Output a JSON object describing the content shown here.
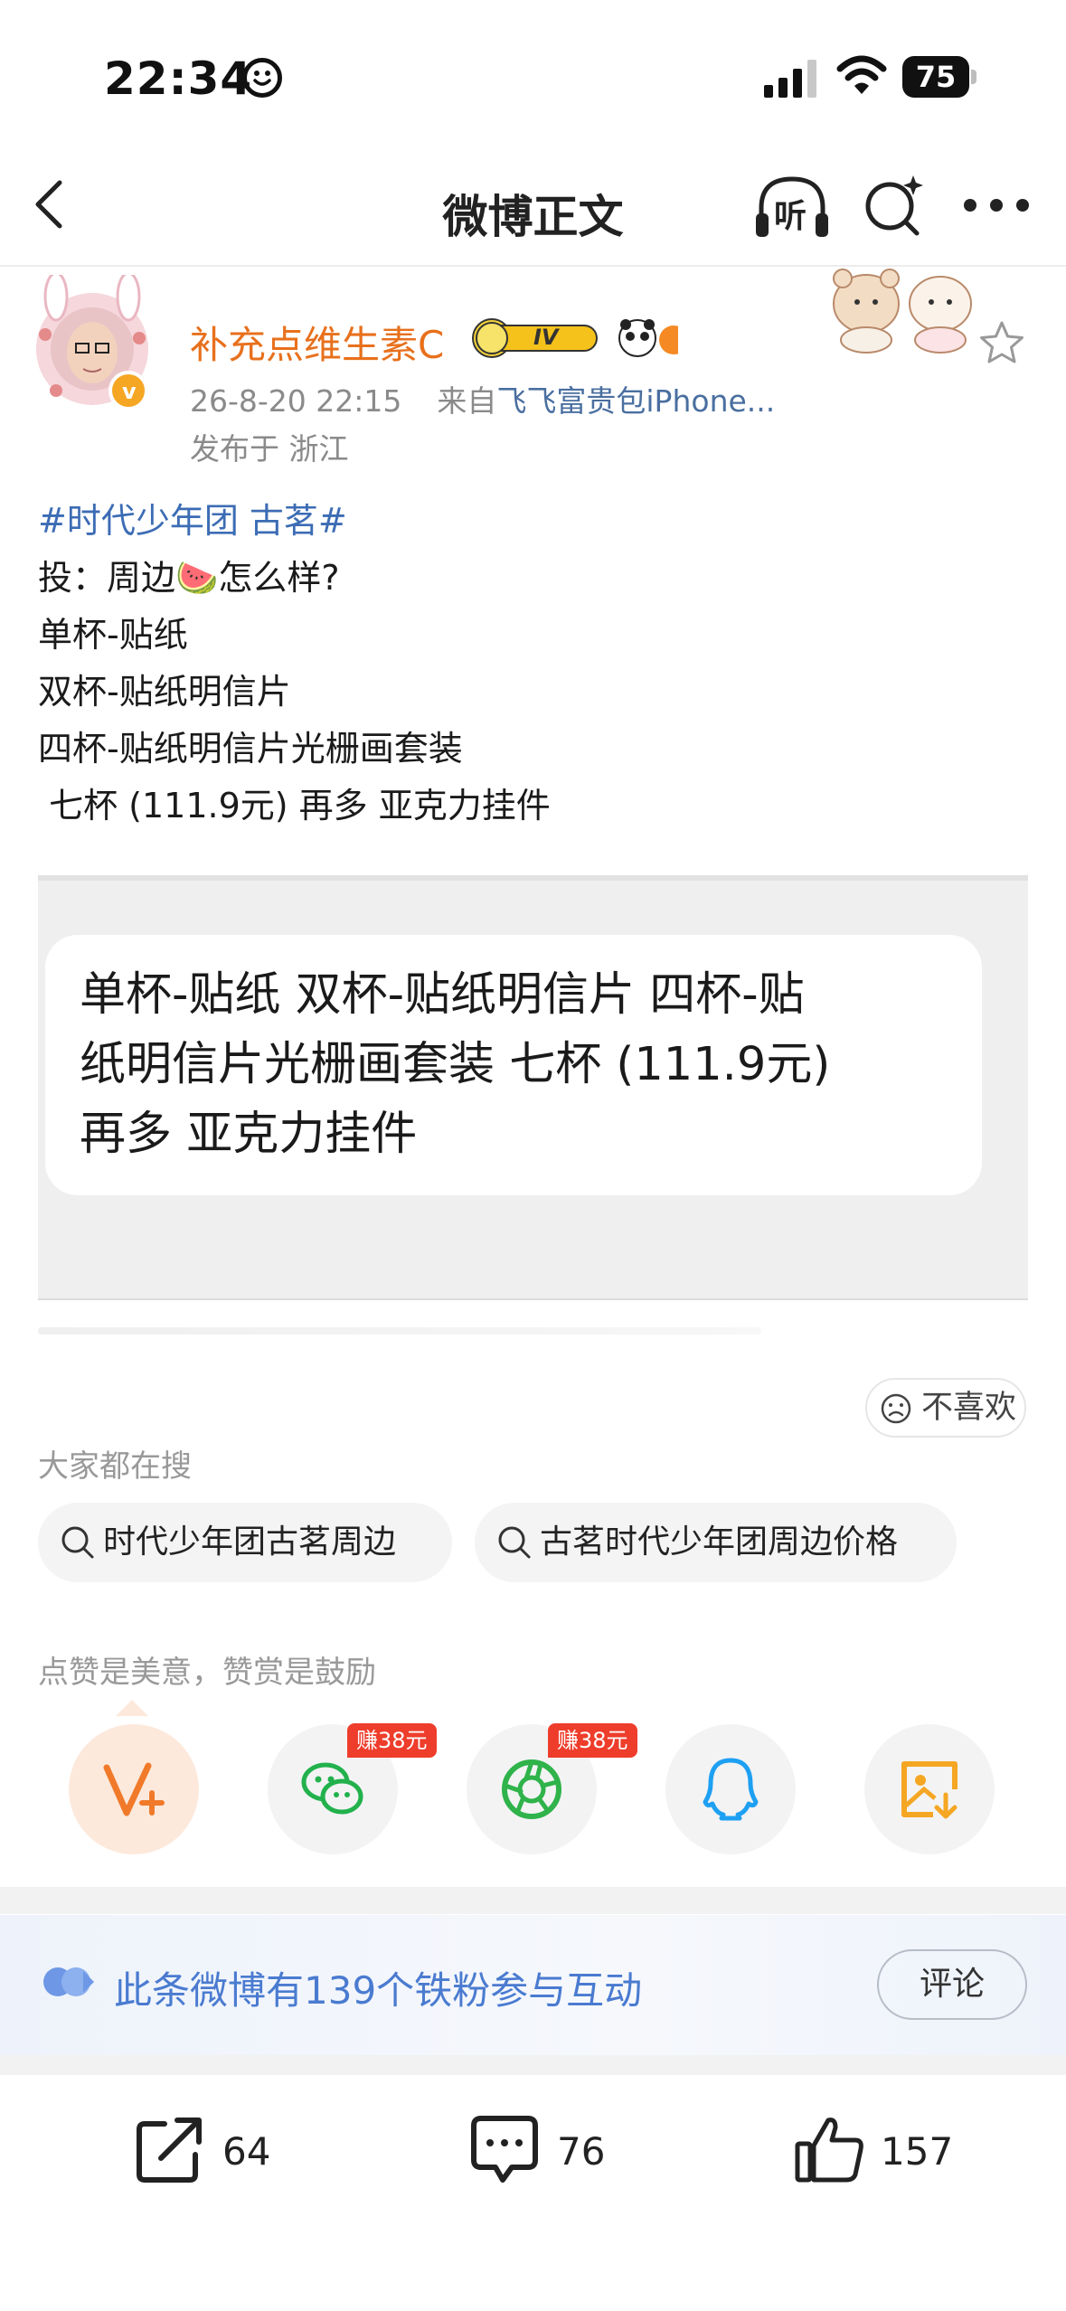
{
  "status_bar": {
    "time": "22:34",
    "battery": "75"
  },
  "nav": {
    "title": "微博正文",
    "listen_label": "听"
  },
  "post": {
    "username": "补充点维生素C",
    "badge_level": "IV",
    "date": "26-8-20 22:15",
    "source_prefix": "来自",
    "source": "飞飞富贵包iPhone...",
    "location": "发布于 浙江",
    "lines": [
      "#时代少年团 古茗#",
      "投：周边🍉怎么样?",
      "单杯-贴纸",
      "双杯-贴纸明信片",
      "四杯-贴纸明信片光栅画套装",
      " 七杯 (111.9元) 再多 亚克力挂件"
    ],
    "image_text_lines": [
      "单杯-贴纸 双杯-贴纸明信片 四杯-贴",
      "纸明信片光栅画套装 七杯 (111.9元)",
      "再多 亚克力挂件"
    ]
  },
  "dislike_label": "不喜欢",
  "search_section": {
    "label": "大家都在搜",
    "chips": [
      "时代少年团古茗周边",
      "古茗时代少年团周边价格"
    ]
  },
  "share_section": {
    "label": "点赞是美意，赞赏是鼓励",
    "earn_tags": [
      "赚38元",
      "赚38元"
    ],
    "icons": [
      "v-plus-icon",
      "wechat-icon",
      "moments-icon",
      "qq-icon",
      "save-image-icon"
    ]
  },
  "fans_banner": {
    "text": "此条微博有139个铁粉参与互动",
    "button": "评论"
  },
  "actions": {
    "reposts": "64",
    "comments": "76",
    "likes": "157"
  },
  "colors": {
    "username": "#e8701c",
    "hashtag": "#3c6cb4",
    "earn_tag": "#ee3d2b",
    "fans_text": "#4a7bd0"
  }
}
